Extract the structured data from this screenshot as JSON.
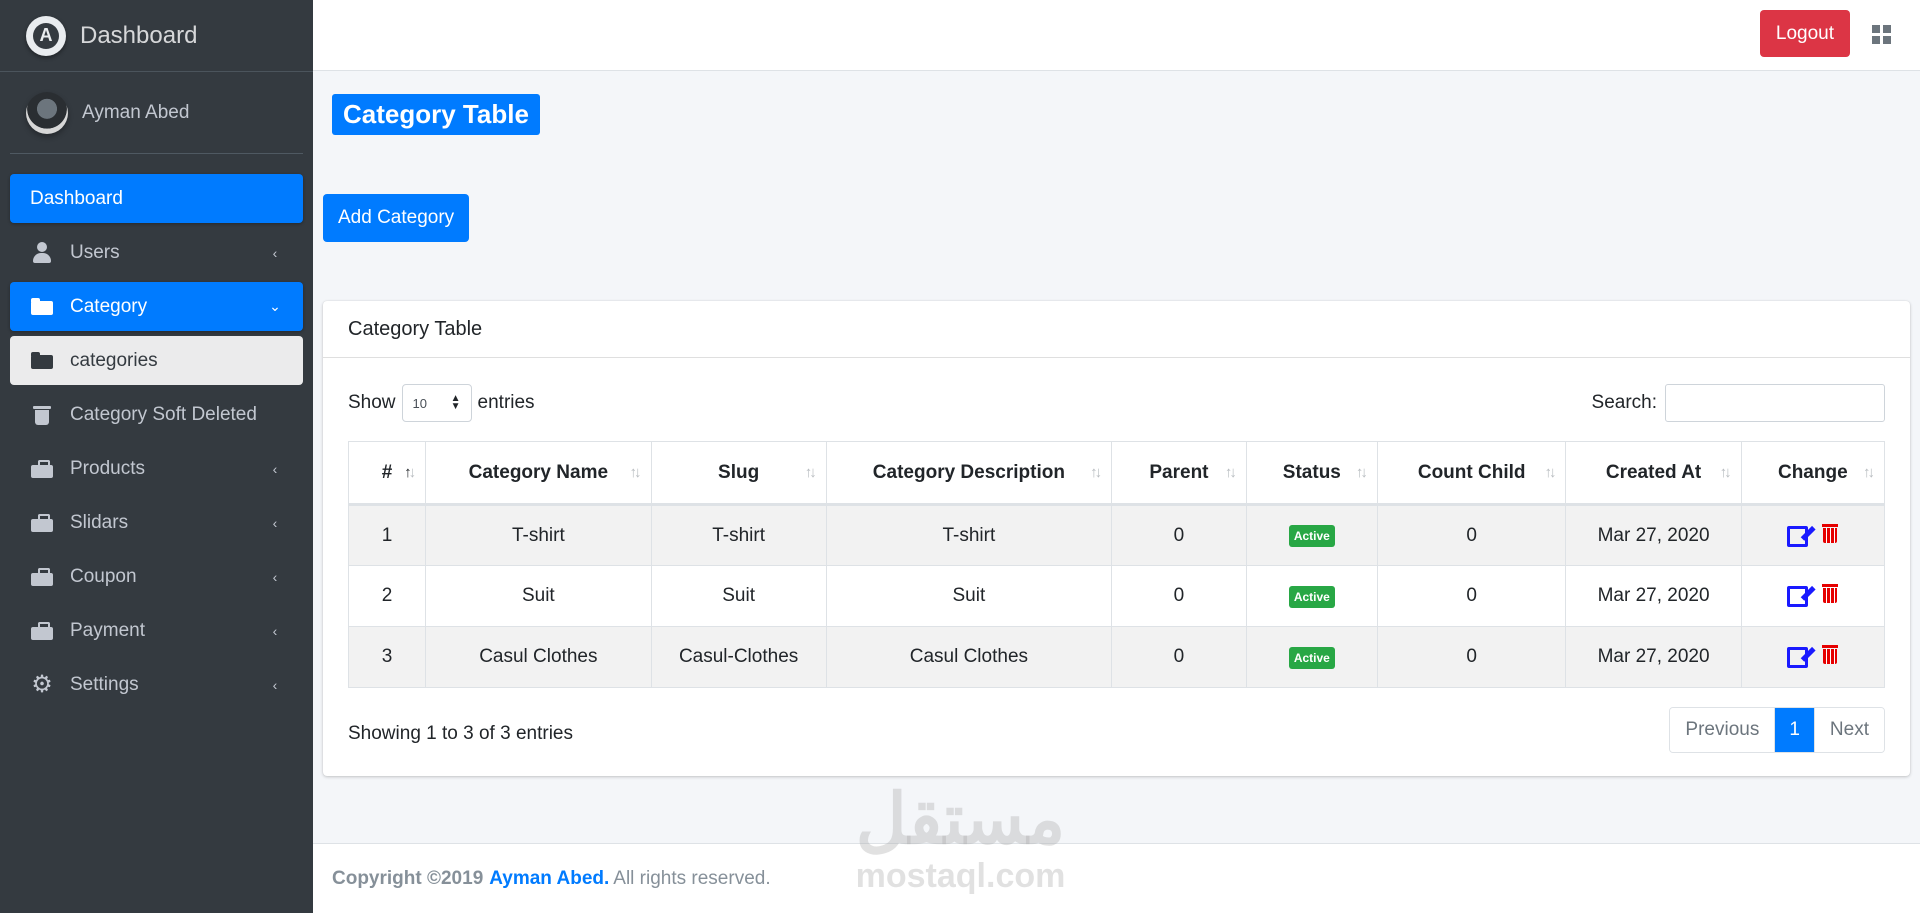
{
  "brand": {
    "title": "Dashboard",
    "logo_letter": "A"
  },
  "user": {
    "name": "Ayman Abed"
  },
  "sidebar": {
    "items": [
      {
        "label": "Dashboard",
        "icon": "none",
        "arrow": ""
      },
      {
        "label": "Users",
        "icon": "user-icon",
        "arrow": "‹"
      },
      {
        "label": "Category",
        "icon": "folder-icon",
        "arrow": "⌄"
      },
      {
        "label": "categories",
        "icon": "folder-icon",
        "arrow": ""
      },
      {
        "label": "Category Soft Deleted",
        "icon": "trash-icon",
        "arrow": ""
      },
      {
        "label": "Products",
        "icon": "briefcase-icon",
        "arrow": "‹"
      },
      {
        "label": "Slidars",
        "icon": "briefcase-icon",
        "arrow": "‹"
      },
      {
        "label": "Coupon",
        "icon": "briefcase-icon",
        "arrow": "‹"
      },
      {
        "label": "Payment",
        "icon": "briefcase-icon",
        "arrow": "‹"
      },
      {
        "label": "Settings",
        "icon": "gear-icon",
        "arrow": "‹"
      }
    ]
  },
  "topbar": {
    "logout_label": "Logout"
  },
  "page": {
    "title": "Category Table",
    "add_button": "Add Category"
  },
  "card": {
    "title": "Category Table",
    "show_label": "Show",
    "entries_label": "entries",
    "entries_value": "10",
    "search_label": "Search:",
    "columns": [
      "#",
      "Category Name",
      "Slug",
      "Category Description",
      "Parent",
      "Status",
      "Count Child",
      "Created At",
      "Change"
    ],
    "rows": [
      {
        "id": "1",
        "name": "T-shirt",
        "slug": "T-shirt",
        "description": "T-shirt",
        "parent": "0",
        "status": "Active",
        "count_child": "0",
        "created_at": "Mar 27, 2020"
      },
      {
        "id": "2",
        "name": "Suit",
        "slug": "Suit",
        "description": "Suit",
        "parent": "0",
        "status": "Active",
        "count_child": "0",
        "created_at": "Mar 27, 2020"
      },
      {
        "id": "3",
        "name": "Casul Clothes",
        "slug": "Casul-Clothes",
        "description": "Casul Clothes",
        "parent": "0",
        "status": "Active",
        "count_child": "0",
        "created_at": "Mar 27, 2020"
      }
    ],
    "info": "Showing 1 to 3 of 3 entries",
    "pagination": {
      "previous": "Previous",
      "current": "1",
      "next": "Next"
    }
  },
  "footer": {
    "copyright": "Copyright ©2019",
    "author": "Ayman Abed.",
    "rights": "All rights reserved."
  },
  "watermark": {
    "arabic": "مستقل",
    "latin": "mostaql.com"
  },
  "colors": {
    "primary": "#007bff",
    "danger": "#dc3545",
    "success": "#28a745",
    "sidebar": "#343a40"
  }
}
